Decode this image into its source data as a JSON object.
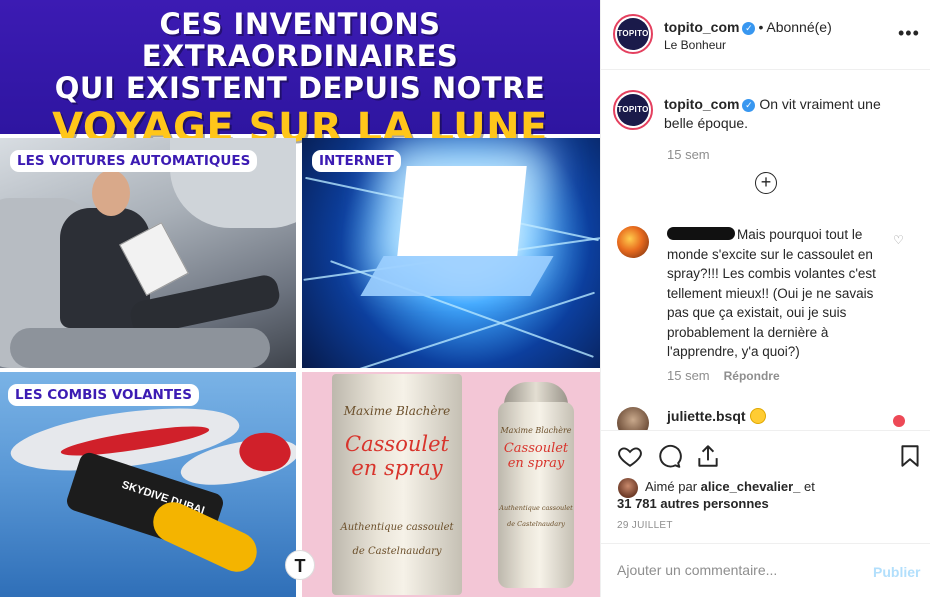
{
  "image": {
    "banner": {
      "line1": "CES INVENTIONS EXTRAORDINAIRES",
      "line2": "QUI EXISTENT DEPUIS NOTRE",
      "line3": "VOYAGE SUR LA LUNE"
    },
    "tiles": [
      {
        "label": "LES VOITURES AUTOMATIQUES"
      },
      {
        "label": "INTERNET"
      },
      {
        "label": "LES COMBIS VOLANTES"
      },
      {
        "label": ""
      }
    ],
    "jetpack_text": "SKYDIVE DUBAI",
    "logo_badge": "T",
    "can_big": {
      "brand": "Maxime Blachère",
      "title": "Cassoulet en spray",
      "subtitle": "Authentique cassoulet",
      "origin": "de Castelnaudary"
    },
    "can_small": {
      "brand": "Maxime Blachère",
      "title": "Cassoulet en spray",
      "subtitle": "Authentique cassoulet",
      "origin": "de Castelnaudary"
    }
  },
  "header": {
    "avatar_text": "TOPITO",
    "username": "topito_com",
    "follow_status": "Abonné(e)",
    "location": "Le Bonheur",
    "more_icon": "more-options-icon"
  },
  "caption": {
    "username": "topito_com",
    "text": "On vit vraiment une belle époque.",
    "time": "15 sem"
  },
  "comments": [
    {
      "text": "Mais pourquoi tout le monde s'excite sur le cassoulet en spray?!!! Les combis volantes c'est tellement mieux!! (Oui je ne savais pas que ça existait, oui je suis probablement la dernière à l'apprendre, y'a quoi?)",
      "time": "15 sem",
      "reply_label": "Répondre"
    },
    {
      "username": "juliette.bsqt",
      "emoji": "grinning-tears-emoji"
    }
  ],
  "likes": {
    "prefix": "Aimé par",
    "first_liker": "alice_chevalier_",
    "connector": "et",
    "others": "31 781 autres personnes"
  },
  "date": "29 JUILLET",
  "add_comment": {
    "placeholder": "Ajouter un commentaire...",
    "publish_label": "Publier"
  },
  "colors": {
    "banner_bg": "#3c1bb3",
    "banner_accent": "#ffc61a",
    "verified": "#3897f0",
    "publish_disabled": "#b2dffc",
    "like_red": "#ed4956"
  }
}
